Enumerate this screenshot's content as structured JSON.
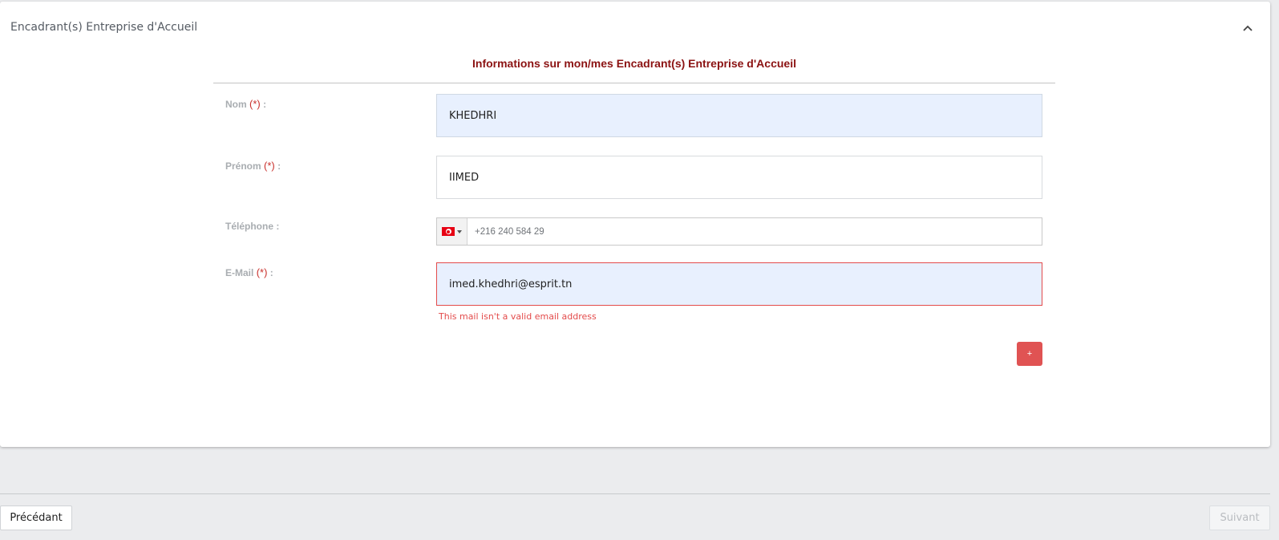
{
  "section": {
    "title": "Encadrant(s) Entreprise d'Accueil",
    "collapse_icon": "chevron-up-icon"
  },
  "form": {
    "title": "Informations sur mon/mes Encadrant(s) Entreprise d'Accueil",
    "required_marker": "(*)",
    "colon": ":",
    "nom": {
      "label": "Nom",
      "value": "KHEDHRI"
    },
    "prenom": {
      "label": "Prénom",
      "value": "IIMED"
    },
    "telephone": {
      "label": "Téléphone :",
      "country": "TN",
      "value": "+216 240 584 29"
    },
    "email": {
      "label": "E-Mail",
      "value": "imed.khedhri@esprit.tn",
      "error": "This mail isn't a valid email address"
    },
    "add_label": "+"
  },
  "footer": {
    "prev_label": "Précédant",
    "next_label": "Suivant"
  },
  "colors": {
    "accent": "#e05353",
    "title": "#8b1212",
    "error": "#e34b4b",
    "autofill_bg": "#e8f0fe"
  }
}
